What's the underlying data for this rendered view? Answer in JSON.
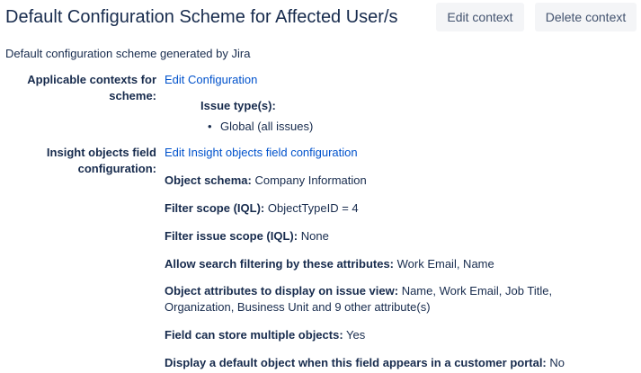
{
  "header": {
    "title": "Default Configuration Scheme for Affected User/s",
    "edit_context_label": "Edit context",
    "delete_context_label": "Delete context"
  },
  "description": "Default configuration scheme generated by Jira",
  "contexts": {
    "label_line1": "Applicable contexts for",
    "label_line2": "scheme:",
    "edit_link": "Edit Configuration",
    "issue_types_label": "Issue type(s):",
    "bullet": "•",
    "issue_types": [
      "Global (all issues)"
    ]
  },
  "insight": {
    "label_line1": "Insight objects field",
    "label_line2": "configuration:",
    "edit_link": "Edit Insight objects field configuration",
    "fields": [
      {
        "label": "Object schema:",
        "value": "Company Information"
      },
      {
        "label": "Filter scope (IQL):",
        "value": "ObjectTypeID = 4"
      },
      {
        "label": "Filter issue scope (IQL):",
        "value": "None"
      },
      {
        "label": "Allow search filtering by these attributes:",
        "value": "Work Email, Name"
      },
      {
        "label": "Object attributes to display on issue view:",
        "value": "Name, Work Email, Job Title,",
        "value_line2": "Organization, Business Unit and 9 other attribute(s)"
      },
      {
        "label": "Field can store multiple objects:",
        "value": "Yes"
      },
      {
        "label": "Display a default object when this field appears in a customer portal:",
        "value": "No"
      }
    ]
  }
}
